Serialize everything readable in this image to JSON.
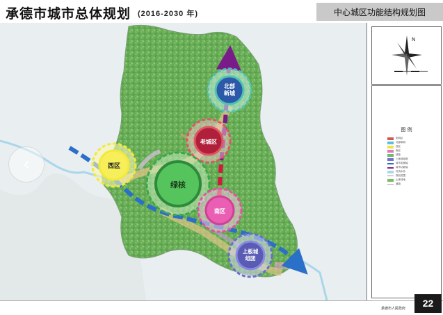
{
  "header": {
    "title": "承德市城市总体规划",
    "subtitle": "(2016-2030 年)",
    "section_title": "中心城区功能结构规划图"
  },
  "map": {
    "districts": [
      {
        "id": "beibu",
        "label_lines": [
          "北部",
          "新城"
        ],
        "ring_color": "#4fc3b3",
        "fill_color": "#2c5aa8"
      },
      {
        "id": "laocheng",
        "label_lines": [
          "老城区"
        ],
        "ring_color": "#e05565",
        "fill_color": "#b0203a"
      },
      {
        "id": "xiqu",
        "label_lines": [
          "西区"
        ],
        "ring_color": "#f2ea3a",
        "fill_color": "#f6ef5a"
      },
      {
        "id": "lühe",
        "label_lines": [
          "绿核"
        ],
        "ring_color": "#3aa84a",
        "fill_color": "#56c45c"
      },
      {
        "id": "nanqu",
        "label_lines": [
          "南区"
        ],
        "ring_color": "#e84fa6",
        "fill_color": "#ea5fb4"
      },
      {
        "id": "shangban",
        "label_lines": [
          "上板城",
          "组团"
        ],
        "ring_color": "#6b6fc8",
        "fill_color": "#5a5bb5"
      }
    ],
    "axes": [
      {
        "id": "north-south-axis",
        "color": "#8b1e7e"
      },
      {
        "id": "east-west-axis",
        "color": "#2a6fc8"
      }
    ]
  },
  "north_arrow": {
    "letter": "N"
  },
  "legend": {
    "title": "图 例",
    "items": [
      {
        "label": "老城区",
        "color": "#d9534f"
      },
      {
        "label": "北部新城",
        "color": "#5bc0de"
      },
      {
        "label": "西区",
        "color": "#f0e442"
      },
      {
        "label": "南区",
        "color": "#e377c2"
      },
      {
        "label": "绿核",
        "color": "#6abe6a"
      },
      {
        "label": "上板城组团",
        "color": "#7b6fc8"
      },
      {
        "label": "城市发展轴",
        "color": "#2a6fc8"
      },
      {
        "label": "城市功能轴",
        "color": "#8b1e7e"
      },
      {
        "label": "河流水系",
        "color": "#a8d8f0"
      },
      {
        "label": "规划范围",
        "color": "#999999"
      },
      {
        "label": "山体绿地",
        "color": "#7dbb6a"
      },
      {
        "label": "道路",
        "color": "#aaaaaa"
      }
    ]
  },
  "footer": {
    "agency": "承德市人民政府",
    "page_number": "22"
  },
  "nav": {
    "prev_glyph": "‹",
    "next_glyph": "›"
  }
}
